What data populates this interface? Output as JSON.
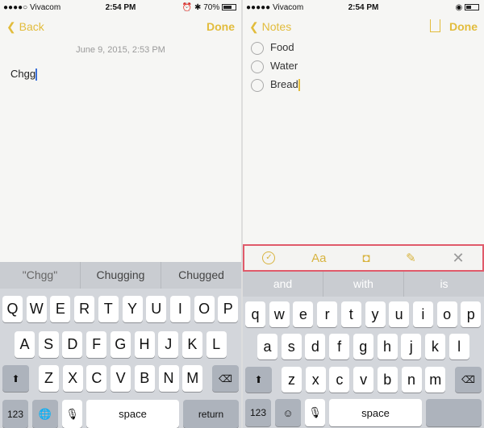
{
  "left": {
    "status": {
      "carrier": "●●●●○ Vivacom",
      "time": "2:54 PM",
      "right": "⏰ ✱ 70%",
      "battery_percent": 70
    },
    "nav": {
      "back": "Back",
      "done": "Done"
    },
    "date": "June 9, 2015, 2:53 PM",
    "note_text": "Chgg",
    "suggestions": [
      "\"Chgg\"",
      "Chugging",
      "Chugged"
    ],
    "keyboard": {
      "row1": [
        "Q",
        "W",
        "E",
        "R",
        "T",
        "Y",
        "U",
        "I",
        "O",
        "P"
      ],
      "row2": [
        "A",
        "S",
        "D",
        "F",
        "G",
        "H",
        "J",
        "K",
        "L"
      ],
      "row3": [
        "Z",
        "X",
        "C",
        "V",
        "B",
        "N",
        "M"
      ],
      "num": "123",
      "space": "space",
      "return": "return"
    }
  },
  "right": {
    "status": {
      "carrier": "●●●●● Vivacom",
      "time": "2:54 PM",
      "right": "◉"
    },
    "nav": {
      "back": "Notes",
      "done": "Done"
    },
    "checklist": [
      "Food",
      "Water",
      "Bread"
    ],
    "toolbar": {
      "check": "✓",
      "format": "Aa",
      "camera": "◘",
      "sketch": "✎",
      "close": "✕"
    },
    "suggestions": [
      "and",
      "with",
      "is"
    ],
    "keyboard": {
      "row1": [
        "q",
        "w",
        "e",
        "r",
        "t",
        "y",
        "u",
        "i",
        "o",
        "p"
      ],
      "row2": [
        "a",
        "s",
        "d",
        "f",
        "g",
        "h",
        "j",
        "k",
        "l"
      ],
      "row3": [
        "z",
        "x",
        "c",
        "v",
        "b",
        "n",
        "m"
      ],
      "num": "123",
      "space": "space"
    }
  },
  "colors": {
    "accent": "#e2bc3c",
    "highlight_border": "#e05a6a",
    "keyboard_bg": "#d3d6db"
  }
}
